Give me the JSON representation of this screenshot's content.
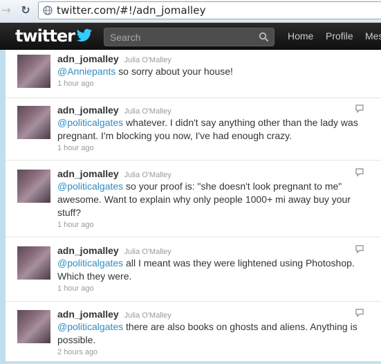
{
  "browser": {
    "url": "twitter.com/#!/adn_jomalley"
  },
  "header": {
    "logo": "twitter",
    "search_placeholder": "Search",
    "nav": [
      "Home",
      "Profile",
      "Mes"
    ]
  },
  "tweets": [
    {
      "screen_name": "adn_jomalley",
      "full_name": "Julia O'Malley",
      "mention": "@Anniepants",
      "text": " so sorry about your house!",
      "time": "1 hour ago"
    },
    {
      "screen_name": "adn_jomalley",
      "full_name": "Julia O'Malley",
      "mention": "@politicalgates",
      "text": " whatever. I didn't say anything other than the lady was pregnant. I'm blocking you now, I've had enough crazy.",
      "time": "1 hour ago"
    },
    {
      "screen_name": "adn_jomalley",
      "full_name": "Julia O'Malley",
      "mention": "@politicalgates",
      "text": " so your proof is: \"she doesn't look pregnant to me\" awesome. Want to explain why only people 1000+ mi away buy your stuff?",
      "time": "1 hour ago"
    },
    {
      "screen_name": "adn_jomalley",
      "full_name": "Julia O'Malley",
      "mention": "@politicalgates",
      "text": " all I meant was they were lightened using Photoshop. Which they were.",
      "time": "1 hour ago"
    },
    {
      "screen_name": "adn_jomalley",
      "full_name": "Julia O'Malley",
      "mention": "@politicalgates",
      "text": " there are also books on ghosts and aliens. Anything is possible.",
      "time": "2 hours ago"
    }
  ]
}
